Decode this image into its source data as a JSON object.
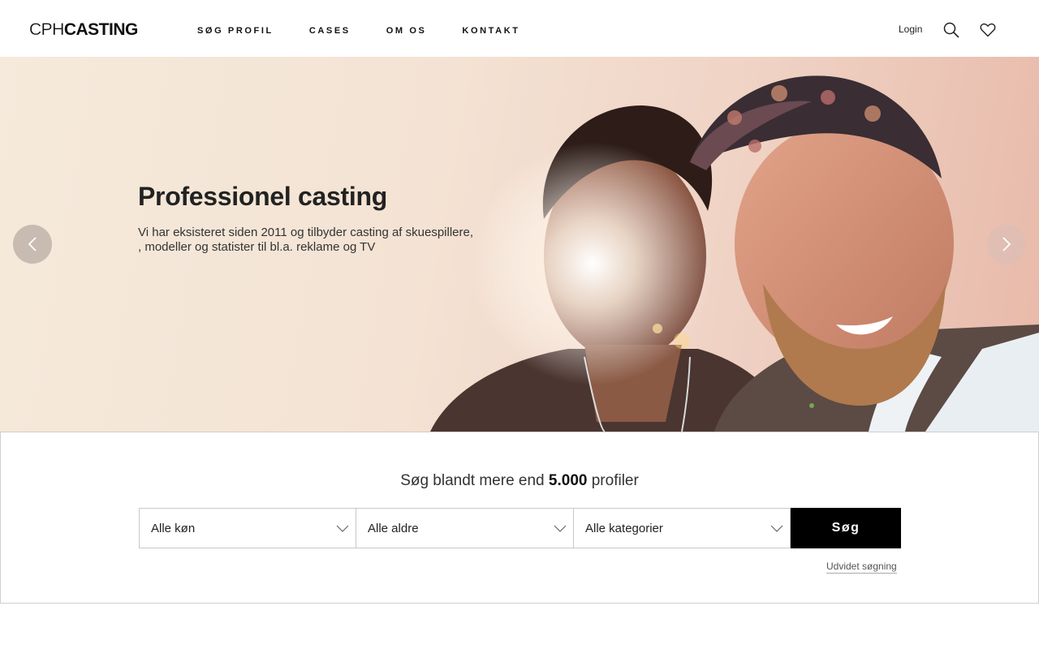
{
  "header": {
    "logo_light": "CPH",
    "logo_bold": "CASTING",
    "nav": [
      "SØG PROFIL",
      "CASES",
      "OM OS",
      "KONTAKT"
    ],
    "login": "Login",
    "icons": [
      "search-icon",
      "heart-icon"
    ]
  },
  "hero": {
    "title": "Professionel casting",
    "text_line1": "Vi har eksisteret siden 2011 og tilbyder casting af skuespillere,",
    "text_line2": ", modeller og statister til bl.a. reklame og TV",
    "prev_icon": "chevron-left-icon",
    "next_icon": "chevron-right-icon"
  },
  "search": {
    "title_prefix": "Søg blandt mere end ",
    "title_count": "5.000",
    "title_suffix": " profiler",
    "gender": "Alle køn",
    "age": "Alle aldre",
    "category": "Alle kategorier",
    "button": "Søg",
    "advanced_link": "Udvidet søgning"
  },
  "colors": {
    "accent": "#000000",
    "hero_bg_light": "#f5eadb",
    "hero_bg_warm": "#e8b9a9"
  }
}
